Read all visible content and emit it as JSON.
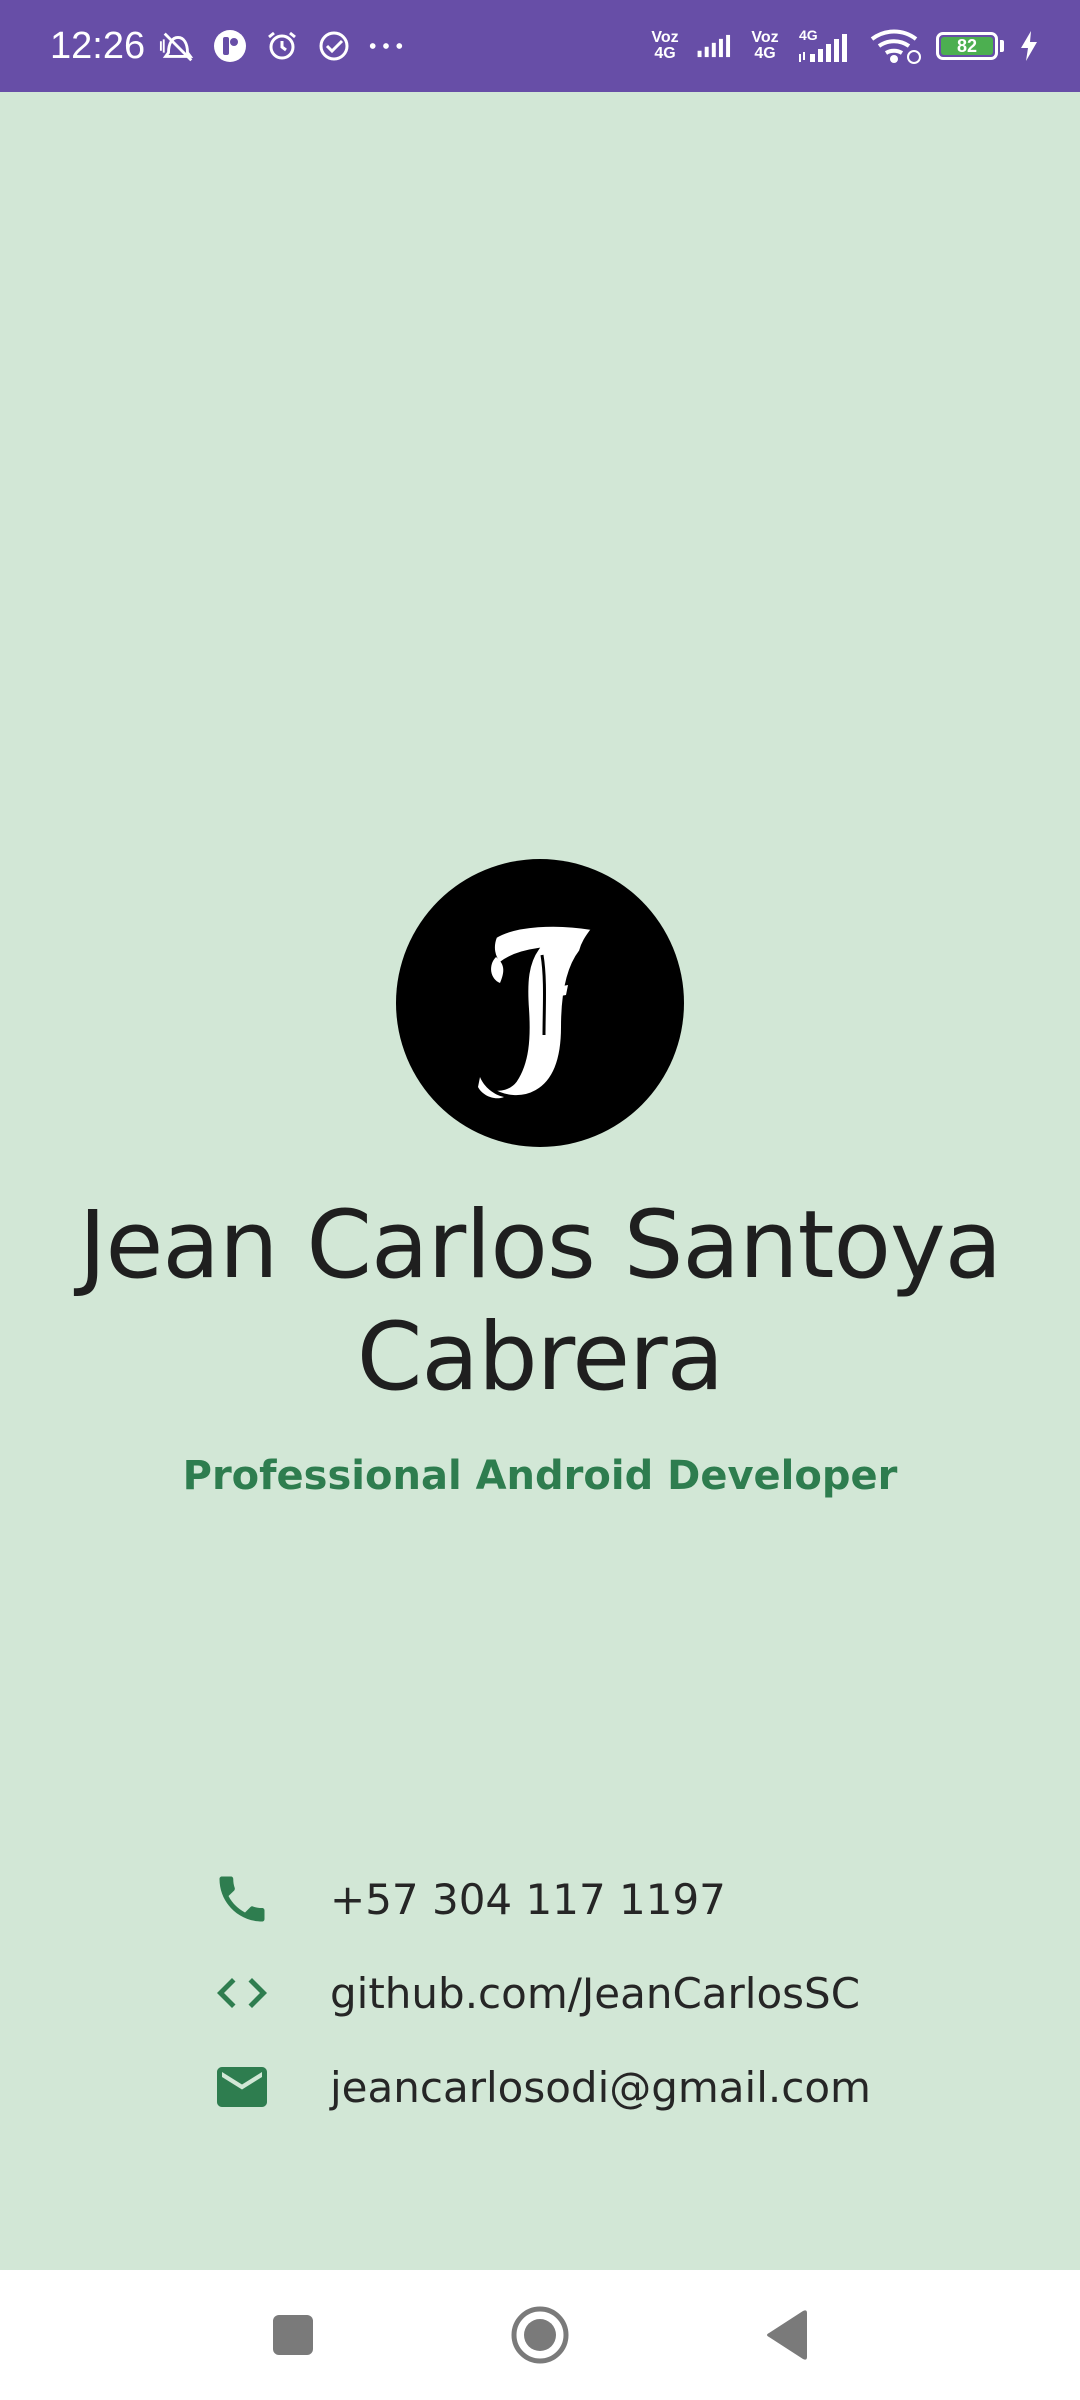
{
  "status_bar": {
    "time": "12:26",
    "net1_label_top": "Voz",
    "net1_label_bottom": "4G",
    "net2_label_top": "Voz",
    "net2_label_bottom": "4G",
    "net3_label": "4G",
    "battery_level": "82",
    "bar_color": "#674ea7",
    "battery_color": "#4caf50"
  },
  "profile": {
    "avatar_letter": "J",
    "name_line1": "Jean Carlos Santoya",
    "name_line2": "Cabrera",
    "title": "Professional Android Developer"
  },
  "contacts": {
    "phone": "+57 304 117 1197",
    "github": "github.com/JeanCarlosSC",
    "email": "jeancarlosodi@gmail.com",
    "accent_color": "#2e7d4f"
  },
  "colors": {
    "background": "#d2e7d6",
    "text": "#1f1f1f"
  },
  "icons": {
    "phone": "phone-icon",
    "code": "code-icon",
    "email": "email-icon",
    "nav_recents": "recents-icon",
    "nav_home": "home-icon",
    "nav_back": "back-icon"
  }
}
